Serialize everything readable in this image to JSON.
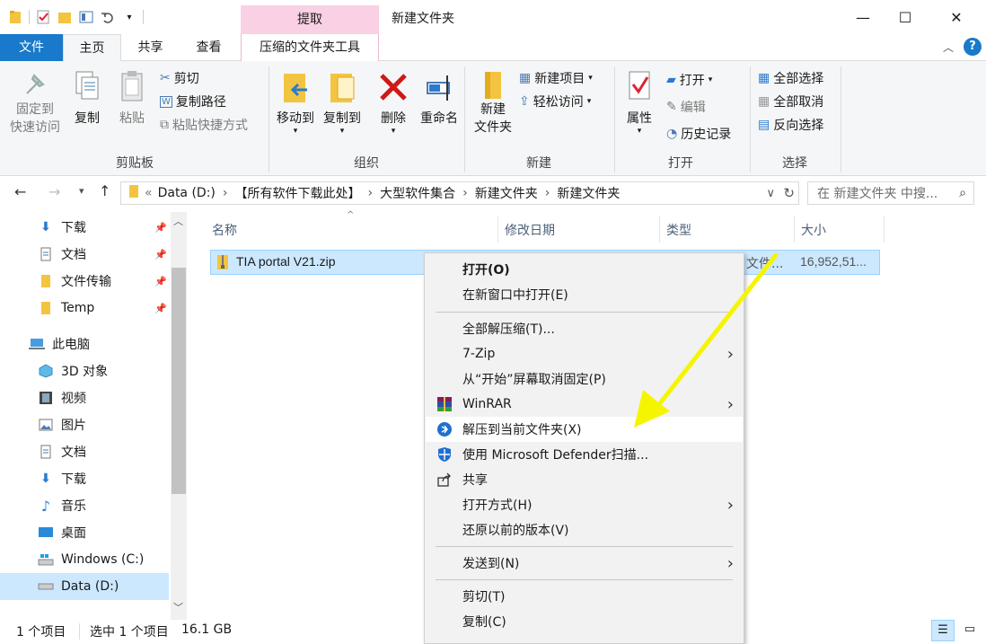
{
  "window": {
    "title": "新建文件夹",
    "context_tab_label": "提取",
    "minimize": "—",
    "maximize": "☐",
    "close": "✕"
  },
  "tabs": {
    "file": "文件",
    "home": "主页",
    "share": "共享",
    "view": "查看",
    "compressed_tools": "压缩的文件夹工具"
  },
  "ribbon": {
    "clipboard": {
      "label": "剪贴板",
      "pin_line1": "固定到",
      "pin_line2": "快速访问",
      "copy": "复制",
      "paste": "粘贴",
      "cut": "剪切",
      "copy_path": "复制路径",
      "paste_shortcut": "粘贴快捷方式"
    },
    "organize": {
      "label": "组织",
      "move_to": "移动到",
      "copy_to": "复制到",
      "delete": "删除",
      "rename": "重命名"
    },
    "new": {
      "label": "新建",
      "new_folder_line1": "新建",
      "new_folder_line2": "文件夹",
      "new_item": "新建项目",
      "easy_access": "轻松访问"
    },
    "open": {
      "label": "打开",
      "properties": "属性",
      "open": "打开",
      "edit": "编辑",
      "history": "历史记录"
    },
    "select": {
      "label": "选择",
      "select_all": "全部选择",
      "select_none": "全部取消",
      "invert": "反向选择"
    }
  },
  "address": {
    "overflow": "«",
    "path": [
      "Data (D:)",
      "【所有软件下载此处】",
      "大型软件集合",
      "新建文件夹",
      "新建文件夹"
    ],
    "search_placeholder": "在 新建文件夹 中搜..."
  },
  "sidebar": {
    "items": [
      {
        "label": "下载",
        "pinned": true
      },
      {
        "label": "文档",
        "pinned": true
      },
      {
        "label": "文件传输",
        "pinned": true
      },
      {
        "label": "Temp",
        "pinned": true
      },
      {
        "label": "此电脑"
      },
      {
        "label": "3D 对象"
      },
      {
        "label": "视频"
      },
      {
        "label": "图片"
      },
      {
        "label": "文档"
      },
      {
        "label": "下载"
      },
      {
        "label": "音乐"
      },
      {
        "label": "桌面"
      },
      {
        "label": "Windows (C:)"
      },
      {
        "label": "Data (D:)"
      }
    ]
  },
  "columns": {
    "name": "名称",
    "modified": "修改日期",
    "type": "类型",
    "size": "大小"
  },
  "file": {
    "name": "TIA portal V21.zip",
    "type_partial": "文件...",
    "size": "16,952,51..."
  },
  "context_menu": {
    "items": [
      {
        "label": "打开(O)",
        "bold": true
      },
      {
        "label": "在新窗口中打开(E)"
      },
      {
        "label": "全部解压缩(T)..."
      },
      {
        "label": "7-Zip",
        "submenu": true
      },
      {
        "label": "从“开始”屏幕取消固定(P)"
      },
      {
        "label": "WinRAR",
        "submenu": true,
        "icon": "winrar-icon"
      },
      {
        "label": "解压到当前文件夹(X)",
        "icon": "bandizip-icon",
        "highlighted": true
      },
      {
        "label": "使用 Microsoft Defender扫描...",
        "icon": "defender-shield-icon"
      },
      {
        "label": "共享",
        "icon": "share-icon"
      },
      {
        "label": "打开方式(H)",
        "submenu": true
      },
      {
        "label": "还原以前的版本(V)"
      },
      {
        "label": "发送到(N)",
        "submenu": true
      },
      {
        "label": "剪切(T)"
      },
      {
        "label": "复制(C)"
      }
    ]
  },
  "status": {
    "count": "1 个项目",
    "selected": "选中 1 个项目",
    "size": "16.1 GB"
  },
  "colors": {
    "file_tab": "#1979ca",
    "context_tab": "#f9d0e4",
    "selection": "#cce8ff",
    "annotation_arrow": "#f5f500"
  }
}
